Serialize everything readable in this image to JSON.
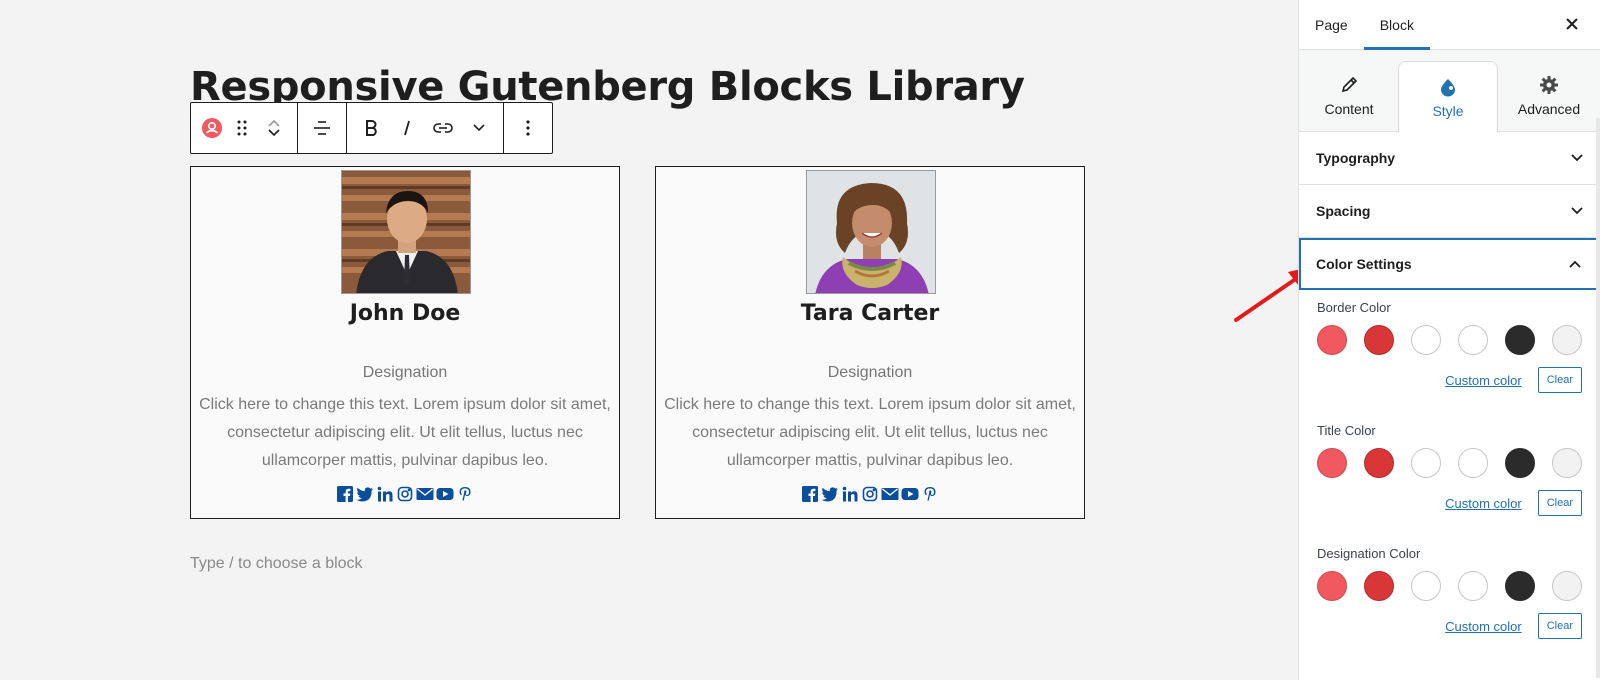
{
  "editor": {
    "title": "Responsive Gutenberg Blocks Library",
    "placeholder": "Type / to choose a block"
  },
  "cards": [
    {
      "name": "John Doe",
      "designation": "Designation",
      "description": "Click here to change this text. Lorem ipsum dolor sit amet, consectetur adipiscing elit. Ut elit tellus, luctus nec ullamcorper mattis, pulvinar dapibus leo."
    },
    {
      "name": "Tara Carter",
      "designation": "Designation",
      "description": "Click here to change this text. Lorem ipsum dolor sit amet, consectetur adipiscing elit. Ut elit tellus, luctus nec ullamcorper mattis, pulvinar dapibus leo."
    }
  ],
  "social_icons": [
    "facebook-icon",
    "twitter-icon",
    "linkedin-icon",
    "instagram-icon",
    "email-icon",
    "youtube-icon",
    "pinterest-icon"
  ],
  "sidebar": {
    "tabs": [
      "Page",
      "Block"
    ],
    "panel_tabs": [
      "Content",
      "Style",
      "Advanced"
    ],
    "sections": [
      "Typography",
      "Spacing",
      "Color Settings"
    ],
    "color_groups": [
      {
        "label": "Border Color",
        "custom": "Custom color",
        "clear": "Clear"
      },
      {
        "label": "Title Color",
        "custom": "Custom color",
        "clear": "Clear"
      },
      {
        "label": "Designation Color",
        "custom": "Custom color",
        "clear": "Clear"
      }
    ],
    "palette": [
      "#f0595f",
      "#d93638",
      "#ffffff",
      "#ffffff",
      "#2b2b2b",
      "#f2f2f2"
    ]
  },
  "colors": {
    "accent": "#2271b1",
    "social": "#0b4f9c",
    "arrow": "#e51a1a"
  }
}
